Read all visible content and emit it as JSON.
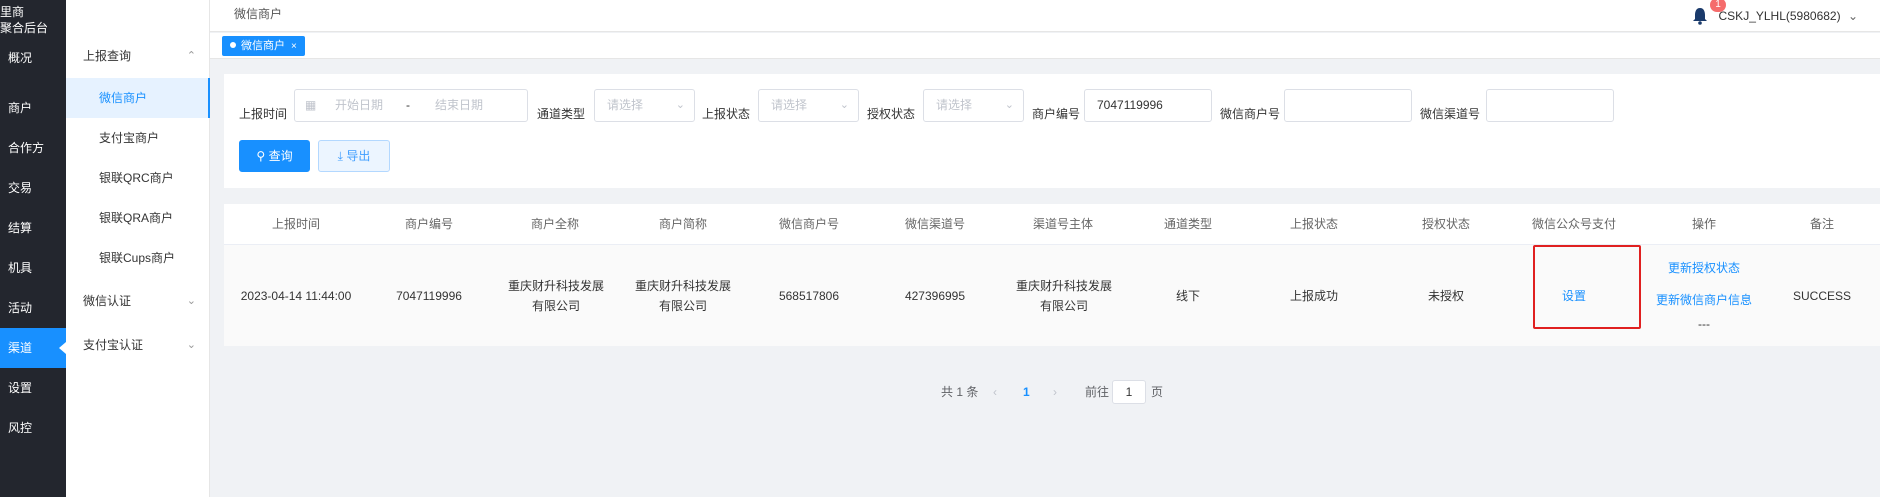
{
  "brand": {
    "line1": "里商",
    "line2": "聚合后台"
  },
  "leftnav": [
    "概况",
    "商户",
    "合作方",
    "交易",
    "结算",
    "机具",
    "活动",
    "渠道",
    "设置",
    "风控"
  ],
  "submenu": {
    "group1": "上报查询",
    "items": [
      "微信商户",
      "支付宝商户",
      "银联QRC商户",
      "银联QRA商户",
      "银联Cups商户"
    ],
    "group2": "微信认证",
    "group3": "支付宝认证"
  },
  "header": {
    "breadcrumb": "微信商户",
    "badge": "1",
    "user": "CSKJ_YLHL(5980682)"
  },
  "tabs": {
    "active": "微信商户",
    "close": "×"
  },
  "filter": {
    "report_time_label": "上报时间",
    "start_placeholder": "开始日期",
    "separator": "-",
    "end_placeholder": "结束日期",
    "channel_type_label": "通道类型",
    "channel_type_placeholder": "请选择",
    "report_status_label": "上报状态",
    "report_status_placeholder": "请选择",
    "auth_status_label": "授权状态",
    "auth_status_placeholder": "请选择",
    "merchant_no_label": "商户编号",
    "merchant_no_value": "7047119996",
    "wx_merchant_no_label": "微信商户号",
    "wx_merchant_no_value": "",
    "wx_channel_no_label": "微信渠道号",
    "wx_channel_no_value": "",
    "query_button": "查询",
    "export_button": "导出"
  },
  "table": {
    "headers": [
      "上报时间",
      "商户编号",
      "商户全称",
      "商户简称",
      "微信商户号",
      "微信渠道号",
      "渠道号主体",
      "通道类型",
      "上报状态",
      "授权状态",
      "微信公众号支付",
      "操作",
      "备注"
    ],
    "row": {
      "report_time": "2023-04-14 11:44:00",
      "merchant_no": "7047119996",
      "full_name": "重庆财升科技发展有限公司",
      "short_name": "重庆财升科技发展有限公司",
      "wx_merchant_no": "568517806",
      "wx_channel_no": "427396995",
      "channel_subject": "重庆财升科技发展有限公司",
      "channel_type": "线下",
      "report_status": "上报成功",
      "auth_status": "未授权",
      "wx_pay_action": "设置",
      "op_update_auth": "更新授权状态",
      "op_update_merchant": "更新微信商户信息",
      "op_dash": "---",
      "remark": "SUCCESS"
    }
  },
  "pagination": {
    "total": "共 1 条",
    "prev": "‹",
    "page": "1",
    "next": "›",
    "goto_label": "前往",
    "goto_value": "1",
    "goto_suffix": "页"
  },
  "colors": {
    "primary": "#1890ff",
    "sidebar": "#23262e",
    "highlight_box": "#e02020"
  }
}
